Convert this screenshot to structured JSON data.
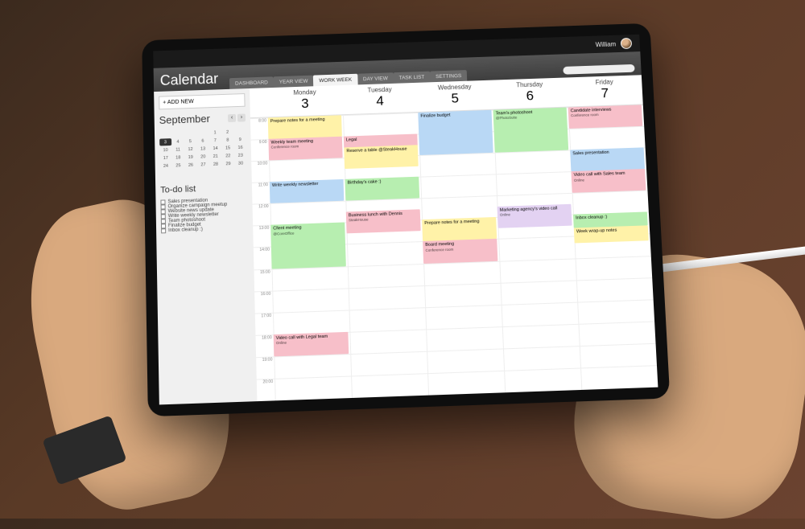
{
  "user": {
    "name": "William"
  },
  "app_title": "Calendar",
  "tabs": [
    "DASHBOARD",
    "YEAR VIEW",
    "WORK WEEK",
    "DAY VIEW",
    "TASK LIST",
    "SETTINGS"
  ],
  "active_tab_index": 2,
  "search_placeholder": "",
  "add_new_label": "+ ADD NEW",
  "month": {
    "name": "September"
  },
  "mini_days": [
    "",
    "",
    "",
    "",
    "1",
    "2",
    "",
    "3",
    "4",
    "5",
    "6",
    "7",
    "8",
    "9",
    "10",
    "11",
    "12",
    "13",
    "14",
    "15",
    "16",
    "17",
    "18",
    "19",
    "20",
    "21",
    "22",
    "23",
    "24",
    "25",
    "26",
    "27",
    "28",
    "29",
    "30",
    "",
    "",
    "",
    "",
    "",
    "",
    ""
  ],
  "mini_selected_index": 7,
  "todo_title": "To-do list",
  "todo": [
    "Sales presentation",
    "Organize campaign meetup",
    "Website news update",
    "Write weekly newsletter",
    "Team photoshoot",
    "Finalize budget",
    "Inbox cleanup :)"
  ],
  "days": [
    {
      "name": "Monday",
      "date": "3"
    },
    {
      "name": "Tuesday",
      "date": "4"
    },
    {
      "name": "Wednesday",
      "date": "5"
    },
    {
      "name": "Thursday",
      "date": "6"
    },
    {
      "name": "Friday",
      "date": "7"
    }
  ],
  "time_slots": [
    "8:00",
    "9:00",
    "10:00",
    "11:00",
    "12:00",
    "13:00",
    "14:00",
    "15:00",
    "16:00",
    "17:00",
    "18:00",
    "19:00",
    "20:00"
  ],
  "colors": {
    "yellow": "#fff2a8",
    "pink": "#f7bfc9",
    "green": "#b7eeb0",
    "blue": "#b9d8f5",
    "lilac": "#e3d2f2"
  },
  "events": [
    {
      "day": 0,
      "start": 0,
      "span": 1,
      "title": "Prepare notes for a meeting",
      "sub": "",
      "color": "yellow"
    },
    {
      "day": 0,
      "start": 1,
      "span": 1,
      "title": "Weekly team meeting",
      "sub": "Conference room",
      "color": "pink"
    },
    {
      "day": 0,
      "start": 3,
      "span": 1,
      "title": "Write weekly newsletter",
      "sub": "",
      "color": "blue"
    },
    {
      "day": 0,
      "start": 5,
      "span": 2,
      "title": "Client meeting",
      "sub": "@CoreOffice",
      "color": "green"
    },
    {
      "day": 0,
      "start": 10,
      "span": 1,
      "title": "Video call with Legal team",
      "sub": "Online",
      "color": "pink"
    },
    {
      "day": 1,
      "start": 1,
      "span": 1,
      "title": "Legal",
      "sub": "",
      "color": "pink"
    },
    {
      "day": 1,
      "start": 1.5,
      "span": 1,
      "title": "Reserve a table @SteakHouse",
      "sub": "",
      "color": "yellow"
    },
    {
      "day": 1,
      "start": 3,
      "span": 1,
      "title": "Birthday's cake :)",
      "sub": "",
      "color": "green"
    },
    {
      "day": 1,
      "start": 4.5,
      "span": 1,
      "title": "Business lunch with Dennis",
      "sub": "SteakHouse",
      "color": "pink"
    },
    {
      "day": 2,
      "start": 0,
      "span": 2,
      "title": "Finalize budget",
      "sub": "",
      "color": "blue"
    },
    {
      "day": 2,
      "start": 5,
      "span": 1,
      "title": "Prepare notes for a meeting",
      "sub": "",
      "color": "yellow"
    },
    {
      "day": 2,
      "start": 6,
      "span": 1,
      "title": "Board meeting",
      "sub": "Conference room",
      "color": "pink"
    },
    {
      "day": 3,
      "start": 0,
      "span": 2,
      "title": "Team's photoshoot",
      "sub": "@PhotoSuite",
      "color": "green"
    },
    {
      "day": 3,
      "start": 4.5,
      "span": 1,
      "title": "Marketing agency's video call",
      "sub": "Online",
      "color": "lilac"
    },
    {
      "day": 4,
      "start": 0,
      "span": 1,
      "title": "Candidate interviews",
      "sub": "Conference room",
      "color": "pink"
    },
    {
      "day": 4,
      "start": 2,
      "span": 1,
      "title": "Sales presentation",
      "sub": "",
      "color": "blue"
    },
    {
      "day": 4,
      "start": 3,
      "span": 1,
      "title": "Video call with Sales team",
      "sub": "Online",
      "color": "pink"
    },
    {
      "day": 4,
      "start": 5,
      "span": 0.6,
      "title": "Inbox cleanup :)",
      "sub": "",
      "color": "green"
    },
    {
      "day": 4,
      "start": 5.6,
      "span": 0.7,
      "title": "Week wrap-up notes",
      "sub": "",
      "color": "yellow"
    }
  ]
}
